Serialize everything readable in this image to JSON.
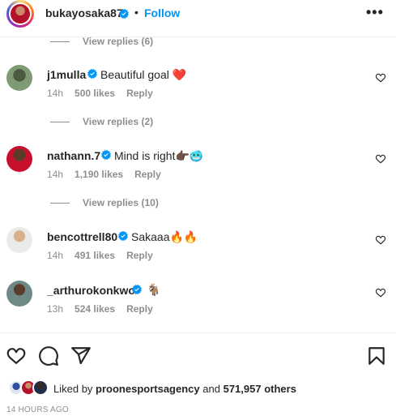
{
  "header": {
    "username": "bukayosaka87",
    "separator": "•",
    "follow_label": "Follow",
    "more_label": "•••"
  },
  "replies_links": [
    {
      "label": "View replies (6)"
    },
    {
      "label": "View replies (2)"
    },
    {
      "label": "View replies (10)"
    }
  ],
  "comments": [
    {
      "username": "j1mulla",
      "text": "Beautiful goal",
      "emoji": "❤️",
      "time": "14h",
      "likes": "500 likes",
      "reply": "Reply",
      "verified": true
    },
    {
      "username": "nathann.7",
      "text": "Mind is right",
      "emoji": "👉🏿🥶",
      "time": "14h",
      "likes": "1,190 likes",
      "reply": "Reply",
      "verified": true
    },
    {
      "username": "bencottrell80",
      "text": "Sakaaa",
      "emoji": "🔥🔥",
      "time": "14h",
      "likes": "491 likes",
      "reply": "Reply",
      "verified": true
    },
    {
      "username": "_arthurokonkwo",
      "text": "",
      "emoji": "🐐",
      "time": "13h",
      "likes": "524 likes",
      "reply": "Reply",
      "verified": true
    }
  ],
  "liked_by": {
    "prefix": "Liked by",
    "user": "proonesportsagency",
    "and": "and",
    "count": "571,957 others"
  },
  "timestamp": "14 HOURS AGO",
  "colors": {
    "accent": "#0095f6",
    "verified": "#0095f6",
    "heart": "#ed4956",
    "muted": "#8e8e8e"
  },
  "icons": {
    "more": "more-horizontal-icon",
    "like": "heart-icon",
    "comment": "comment-bubble-icon",
    "share": "paper-plane-icon",
    "save": "bookmark-icon"
  }
}
